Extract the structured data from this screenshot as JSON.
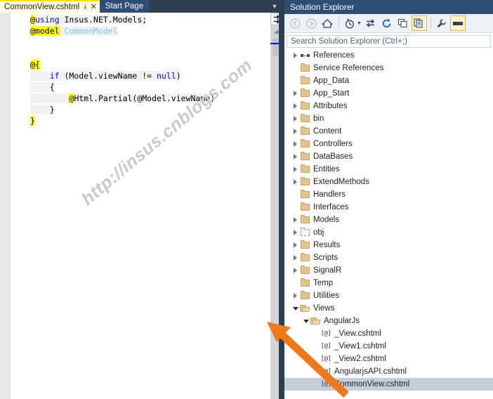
{
  "editor": {
    "tabs": [
      {
        "label": "CommonView.cshtml",
        "active": true,
        "pin_icon": "pin-icon",
        "close_icon": "close-icon"
      },
      {
        "label": "Start Page",
        "active": false
      }
    ],
    "overflow_icon": "chevron-down-icon",
    "code_lines": [
      [
        {
          "t": "@",
          "c": "at"
        },
        {
          "t": "using",
          "c": "kw"
        },
        {
          "t": " Insus.NET.Models;",
          "c": "plain"
        }
      ],
      [
        {
          "t": "@model",
          "c": "at"
        },
        {
          "t": " ",
          "c": "plain"
        },
        {
          "t": "CommonModel",
          "c": "type"
        }
      ],
      [],
      [],
      [
        {
          "t": "@{",
          "c": "at"
        }
      ],
      [
        {
          "t": "    ",
          "c": "plain"
        },
        {
          "t": "if",
          "c": "kw"
        },
        {
          "t": " (Model.viewName != ",
          "c": "plain"
        },
        {
          "t": "null",
          "c": "kw"
        },
        {
          "t": ")",
          "c": "plain"
        }
      ],
      [
        {
          "t": "    {",
          "c": "plain"
        }
      ],
      [
        {
          "t": "        ",
          "c": "plain"
        },
        {
          "t": "@",
          "c": "at"
        },
        {
          "t": "Html.Partial(@Model.viewName)",
          "c": "plain"
        }
      ],
      [
        {
          "t": "    }",
          "c": "plain"
        }
      ],
      [
        {
          "t": "}",
          "c": "at"
        }
      ]
    ],
    "watermark": "http://insus.cnblogs.com",
    "scrollbar": {
      "split_icon": "split-editor-icon",
      "up_icon": "scroll-up-arrow-icon",
      "thumb_name": "scroll-thumb",
      "marker_color": "#0000ff"
    }
  },
  "solution_explorer": {
    "title": "Solution Explorer",
    "toolbar": [
      {
        "name": "back-icon",
        "disabled": true,
        "active": false
      },
      {
        "name": "forward-icon",
        "disabled": true,
        "active": false
      },
      {
        "name": "home-icon",
        "disabled": false,
        "active": false
      },
      {
        "name": "separator",
        "disabled": false,
        "active": false
      },
      {
        "name": "pending-changes-icon",
        "disabled": false,
        "active": false
      },
      {
        "name": "dropdown-caret-icon",
        "disabled": false,
        "active": false
      },
      {
        "name": "sync-views-icon",
        "disabled": false,
        "active": false
      },
      {
        "name": "refresh-icon",
        "disabled": false,
        "active": false
      },
      {
        "name": "collapse-all-icon",
        "disabled": false,
        "active": false
      },
      {
        "name": "show-all-files-icon",
        "disabled": false,
        "active": true
      },
      {
        "name": "separator",
        "disabled": false,
        "active": false
      },
      {
        "name": "properties-icon",
        "disabled": false,
        "active": false
      },
      {
        "name": "preview-selected-icon",
        "disabled": false,
        "active": true
      }
    ],
    "search_placeholder": "Search Solution Explorer (Ctrl+;)",
    "tree": [
      {
        "label": "References",
        "icon": "references-icon",
        "indent": 1,
        "twisty": "collapsed",
        "selected": false
      },
      {
        "label": "Service References",
        "icon": "folder-icon",
        "indent": 1,
        "twisty": "none",
        "selected": false
      },
      {
        "label": "App_Data",
        "icon": "folder-icon",
        "indent": 1,
        "twisty": "none",
        "selected": false
      },
      {
        "label": "App_Start",
        "icon": "folder-icon",
        "indent": 1,
        "twisty": "collapsed",
        "selected": false
      },
      {
        "label": "Attributes",
        "icon": "folder-icon",
        "indent": 1,
        "twisty": "collapsed",
        "selected": false
      },
      {
        "label": "bin",
        "icon": "folder-icon",
        "indent": 1,
        "twisty": "collapsed",
        "selected": false
      },
      {
        "label": "Content",
        "icon": "folder-icon",
        "indent": 1,
        "twisty": "collapsed",
        "selected": false
      },
      {
        "label": "Controllers",
        "icon": "folder-icon",
        "indent": 1,
        "twisty": "collapsed",
        "selected": false
      },
      {
        "label": "DataBases",
        "icon": "folder-icon",
        "indent": 1,
        "twisty": "collapsed",
        "selected": false
      },
      {
        "label": "Entities",
        "icon": "folder-icon",
        "indent": 1,
        "twisty": "collapsed",
        "selected": false
      },
      {
        "label": "ExtendMethods",
        "icon": "folder-icon",
        "indent": 1,
        "twisty": "collapsed",
        "selected": false
      },
      {
        "label": "Handlers",
        "icon": "folder-icon",
        "indent": 1,
        "twisty": "none",
        "selected": false
      },
      {
        "label": "Interfaces",
        "icon": "folder-icon",
        "indent": 1,
        "twisty": "none",
        "selected": false
      },
      {
        "label": "Models",
        "icon": "folder-icon",
        "indent": 1,
        "twisty": "collapsed",
        "selected": false
      },
      {
        "label": "obj",
        "icon": "folder-excluded-icon",
        "indent": 1,
        "twisty": "collapsed",
        "selected": false
      },
      {
        "label": "Results",
        "icon": "folder-icon",
        "indent": 1,
        "twisty": "collapsed",
        "selected": false
      },
      {
        "label": "Scripts",
        "icon": "folder-icon",
        "indent": 1,
        "twisty": "collapsed",
        "selected": false
      },
      {
        "label": "SignalR",
        "icon": "folder-icon",
        "indent": 1,
        "twisty": "collapsed",
        "selected": false
      },
      {
        "label": "Temp",
        "icon": "folder-icon",
        "indent": 1,
        "twisty": "none",
        "selected": false
      },
      {
        "label": "Utilities",
        "icon": "folder-icon",
        "indent": 1,
        "twisty": "collapsed",
        "selected": false
      },
      {
        "label": "Views",
        "icon": "folder-open-icon",
        "indent": 1,
        "twisty": "expanded",
        "selected": false
      },
      {
        "label": "AngularJs",
        "icon": "folder-open-icon",
        "indent": 2,
        "twisty": "expanded",
        "selected": false
      },
      {
        "label": "_View.cshtml",
        "icon": "cshtml-icon",
        "indent": 3,
        "twisty": "none",
        "selected": false
      },
      {
        "label": "_View1.cshtml",
        "icon": "cshtml-icon",
        "indent": 3,
        "twisty": "none",
        "selected": false
      },
      {
        "label": "_View2.cshtml",
        "icon": "cshtml-icon",
        "indent": 3,
        "twisty": "none",
        "selected": false
      },
      {
        "label": "AngularjsAPI.cshtml",
        "icon": "cshtml-icon",
        "indent": 3,
        "twisty": "none",
        "selected": false
      },
      {
        "label": "CommonView.cshtml",
        "icon": "cshtml-icon",
        "indent": 3,
        "twisty": "none",
        "selected": true
      }
    ]
  },
  "annotation": {
    "arrow_color": "#f07818",
    "arrow_name": "orange-pointer-arrow"
  }
}
